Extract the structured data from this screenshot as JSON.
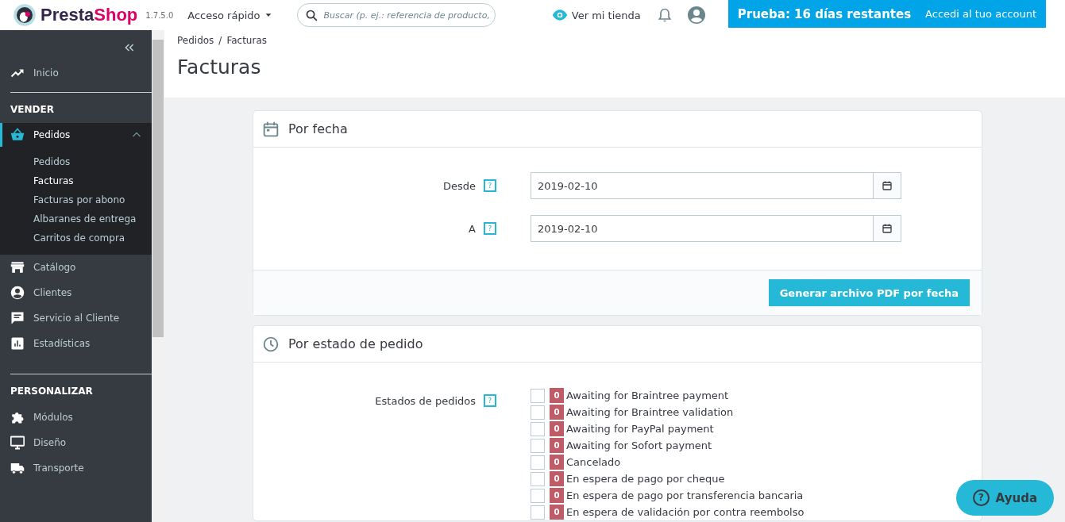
{
  "header": {
    "brand": {
      "parts": [
        "Presta",
        "Shop"
      ]
    },
    "version": "1.7.5.0",
    "quick_access": "Acceso rápido",
    "search": {
      "placeholder": "Buscar (p. ej.: referencia de producto,"
    },
    "view_store": "Ver mi tienda",
    "trial_banner": {
      "title": "Prueba: 16 días restantes",
      "link": "Accedi al tuo account"
    }
  },
  "sidebar": {
    "sections": [
      {
        "items": [
          {
            "label": "Inicio",
            "selected": false
          }
        ]
      },
      {
        "title": "VENDER",
        "items": [
          {
            "label": "Pedidos",
            "selected": true,
            "expanded": true,
            "children": [
              {
                "label": "Pedidos",
                "selected": false
              },
              {
                "label": "Facturas",
                "selected": true
              },
              {
                "label": "Facturas por abono",
                "selected": false
              },
              {
                "label": "Albaranes de entrega",
                "selected": false
              },
              {
                "label": "Carritos de compra",
                "selected": false
              }
            ]
          },
          {
            "label": "Catálogo",
            "selected": false
          },
          {
            "label": "Clientes",
            "selected": false
          },
          {
            "label": "Servicio al Cliente",
            "selected": false
          },
          {
            "label": "Estadísticas",
            "selected": false
          }
        ]
      },
      {
        "title": "PERSONALIZAR",
        "items": [
          {
            "label": "Módulos",
            "selected": false
          },
          {
            "label": "Diseño",
            "selected": false
          },
          {
            "label": "Transporte",
            "selected": false
          }
        ]
      }
    ]
  },
  "breadcrumb": {
    "items": [
      "Pedidos",
      "Facturas"
    ],
    "separator": "/"
  },
  "page_title": "Facturas",
  "by_date": {
    "title": "Por fecha",
    "fields": [
      {
        "label": "Desde",
        "hint": "?",
        "value": "2019-02-10"
      },
      {
        "label": "A",
        "hint": "?",
        "value": "2019-02-10"
      }
    ],
    "button": "Generar archivo PDF por fecha"
  },
  "by_status": {
    "title": "Por estado de pedido",
    "label": "Estados de pedidos",
    "hint": "?",
    "statuses": [
      {
        "count": "0",
        "label": "Awaiting for Braintree payment",
        "checked": false
      },
      {
        "count": "0",
        "label": "Awaiting for Braintree validation",
        "checked": false
      },
      {
        "count": "0",
        "label": "Awaiting for PayPal payment",
        "checked": false
      },
      {
        "count": "0",
        "label": "Awaiting for Sofort payment",
        "checked": false
      },
      {
        "count": "0",
        "label": "Cancelado",
        "checked": false
      },
      {
        "count": "0",
        "label": "En espera de pago por cheque",
        "checked": false
      },
      {
        "count": "0",
        "label": "En espera de pago por transferencia bancaria",
        "checked": false
      },
      {
        "count": "0",
        "label": "En espera de validación por contra reembolso",
        "checked": false
      }
    ]
  },
  "help_button": {
    "icon": "?",
    "label": "Ayuda"
  }
}
